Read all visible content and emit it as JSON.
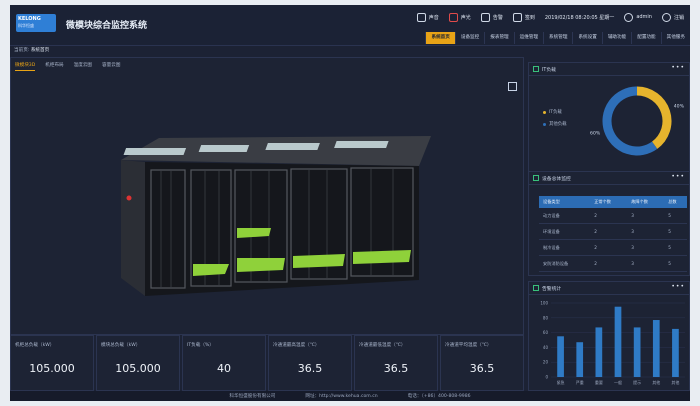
{
  "header": {
    "logo_text": "KELONG",
    "logo_sub": "科华恒盛",
    "app_title": "微模块综合监控系统",
    "utilities": [
      {
        "name": "sound-icon",
        "label": "声音",
        "red": false
      },
      {
        "name": "alarm-sound-icon",
        "label": "声光",
        "red": true
      },
      {
        "name": "warning-icon",
        "label": "告警",
        "red": false
      },
      {
        "name": "shift-icon",
        "label": "签到",
        "red": false
      }
    ],
    "datetime": "2019/02/18  08:20:05  星期一",
    "user": "admin",
    "logout": "注销"
  },
  "nav": [
    "系统首页",
    "设备监控",
    "报表管理",
    "运维管理",
    "系统管理",
    "系统设置",
    "辅助功能",
    "配置功能",
    "其他服务"
  ],
  "breadcrumb": {
    "parent": "当前页:",
    "current": "系统首页"
  },
  "tabs": [
    "微模块3D",
    "机柜布局",
    "温度云图",
    "容量云图"
  ],
  "metrics": [
    {
      "label": "机柜总负载（kW）",
      "value": "105.000"
    },
    {
      "label": "模块总负载（kW）",
      "value": "105.000"
    },
    {
      "label": "IT负载（%）",
      "value": "40"
    },
    {
      "label": "冷通道最高温度（℃）",
      "value": "36.5"
    },
    {
      "label": "冷通道最低温度（℃）",
      "value": "36.5"
    },
    {
      "label": "冷通道平均温度（℃）",
      "value": "36.5"
    }
  ],
  "footer": {
    "company": "科华恒盛股份有限公司",
    "website": "网址：http://www.kehua.com.cn",
    "phone": "电话：（+86）400-808-9986"
  },
  "panel_it": {
    "title": "IT负载",
    "legend": [
      {
        "label": "IT负载",
        "color": "#e6b42d"
      },
      {
        "label": "其他负载",
        "color": "#2e6fb8"
      }
    ],
    "chart_data": {
      "type": "pie",
      "categories": [
        "IT负载",
        "其他负载"
      ],
      "values": [
        40,
        60
      ],
      "labels": [
        "40%",
        "60%"
      ]
    }
  },
  "panel_devices": {
    "title": "设备总体监控",
    "columns": [
      "设备类型",
      "正常个数",
      "故障个数",
      "总数"
    ],
    "rows": [
      [
        "动力设备",
        "2",
        "3",
        "5"
      ],
      [
        "环境设备",
        "2",
        "3",
        "5"
      ],
      [
        "制冷设备",
        "2",
        "3",
        "5"
      ],
      [
        "安防消防设备",
        "2",
        "3",
        "5"
      ]
    ]
  },
  "panel_alarm": {
    "title": "告警统计",
    "chart_data": {
      "type": "bar",
      "categories": [
        "紧急",
        "严重",
        "重要",
        "一般",
        "提示",
        "其他",
        "其他"
      ],
      "values": [
        55,
        47,
        67,
        95,
        67,
        77,
        65
      ],
      "ylim": [
        0,
        100
      ],
      "yticks": [
        0,
        20,
        40,
        60,
        80,
        100
      ],
      "color": "#2f7bc6"
    }
  },
  "colors": {
    "accent": "#e8a316",
    "panel": "#1d2334",
    "green": "#8fd13a"
  }
}
